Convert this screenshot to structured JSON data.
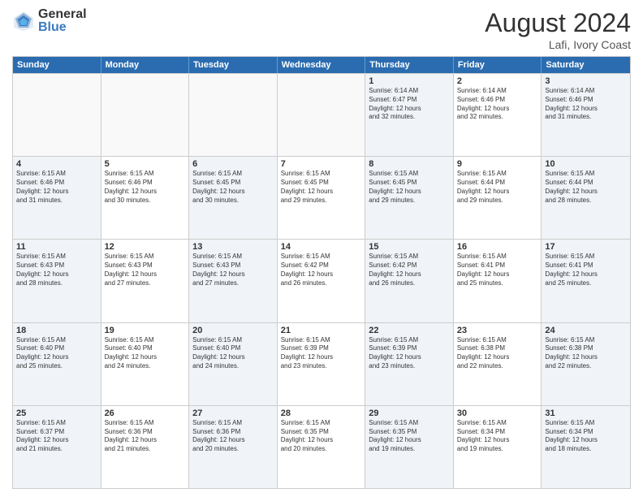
{
  "logo": {
    "general": "General",
    "blue": "Blue"
  },
  "title": "August 2024",
  "location": "Lafi, Ivory Coast",
  "days": [
    "Sunday",
    "Monday",
    "Tuesday",
    "Wednesday",
    "Thursday",
    "Friday",
    "Saturday"
  ],
  "weeks": [
    [
      {
        "day": "",
        "text": "",
        "empty": true
      },
      {
        "day": "",
        "text": "",
        "empty": true
      },
      {
        "day": "",
        "text": "",
        "empty": true
      },
      {
        "day": "",
        "text": "",
        "empty": true
      },
      {
        "day": "1",
        "text": "Sunrise: 6:14 AM\nSunset: 6:47 PM\nDaylight: 12 hours\nand 32 minutes.",
        "empty": false
      },
      {
        "day": "2",
        "text": "Sunrise: 6:14 AM\nSunset: 6:46 PM\nDaylight: 12 hours\nand 32 minutes.",
        "empty": false
      },
      {
        "day": "3",
        "text": "Sunrise: 6:14 AM\nSunset: 6:46 PM\nDaylight: 12 hours\nand 31 minutes.",
        "empty": false
      }
    ],
    [
      {
        "day": "4",
        "text": "Sunrise: 6:15 AM\nSunset: 6:46 PM\nDaylight: 12 hours\nand 31 minutes.",
        "empty": false
      },
      {
        "day": "5",
        "text": "Sunrise: 6:15 AM\nSunset: 6:46 PM\nDaylight: 12 hours\nand 30 minutes.",
        "empty": false
      },
      {
        "day": "6",
        "text": "Sunrise: 6:15 AM\nSunset: 6:45 PM\nDaylight: 12 hours\nand 30 minutes.",
        "empty": false
      },
      {
        "day": "7",
        "text": "Sunrise: 6:15 AM\nSunset: 6:45 PM\nDaylight: 12 hours\nand 29 minutes.",
        "empty": false
      },
      {
        "day": "8",
        "text": "Sunrise: 6:15 AM\nSunset: 6:45 PM\nDaylight: 12 hours\nand 29 minutes.",
        "empty": false
      },
      {
        "day": "9",
        "text": "Sunrise: 6:15 AM\nSunset: 6:44 PM\nDaylight: 12 hours\nand 29 minutes.",
        "empty": false
      },
      {
        "day": "10",
        "text": "Sunrise: 6:15 AM\nSunset: 6:44 PM\nDaylight: 12 hours\nand 28 minutes.",
        "empty": false
      }
    ],
    [
      {
        "day": "11",
        "text": "Sunrise: 6:15 AM\nSunset: 6:43 PM\nDaylight: 12 hours\nand 28 minutes.",
        "empty": false
      },
      {
        "day": "12",
        "text": "Sunrise: 6:15 AM\nSunset: 6:43 PM\nDaylight: 12 hours\nand 27 minutes.",
        "empty": false
      },
      {
        "day": "13",
        "text": "Sunrise: 6:15 AM\nSunset: 6:43 PM\nDaylight: 12 hours\nand 27 minutes.",
        "empty": false
      },
      {
        "day": "14",
        "text": "Sunrise: 6:15 AM\nSunset: 6:42 PM\nDaylight: 12 hours\nand 26 minutes.",
        "empty": false
      },
      {
        "day": "15",
        "text": "Sunrise: 6:15 AM\nSunset: 6:42 PM\nDaylight: 12 hours\nand 26 minutes.",
        "empty": false
      },
      {
        "day": "16",
        "text": "Sunrise: 6:15 AM\nSunset: 6:41 PM\nDaylight: 12 hours\nand 25 minutes.",
        "empty": false
      },
      {
        "day": "17",
        "text": "Sunrise: 6:15 AM\nSunset: 6:41 PM\nDaylight: 12 hours\nand 25 minutes.",
        "empty": false
      }
    ],
    [
      {
        "day": "18",
        "text": "Sunrise: 6:15 AM\nSunset: 6:40 PM\nDaylight: 12 hours\nand 25 minutes.",
        "empty": false
      },
      {
        "day": "19",
        "text": "Sunrise: 6:15 AM\nSunset: 6:40 PM\nDaylight: 12 hours\nand 24 minutes.",
        "empty": false
      },
      {
        "day": "20",
        "text": "Sunrise: 6:15 AM\nSunset: 6:40 PM\nDaylight: 12 hours\nand 24 minutes.",
        "empty": false
      },
      {
        "day": "21",
        "text": "Sunrise: 6:15 AM\nSunset: 6:39 PM\nDaylight: 12 hours\nand 23 minutes.",
        "empty": false
      },
      {
        "day": "22",
        "text": "Sunrise: 6:15 AM\nSunset: 6:39 PM\nDaylight: 12 hours\nand 23 minutes.",
        "empty": false
      },
      {
        "day": "23",
        "text": "Sunrise: 6:15 AM\nSunset: 6:38 PM\nDaylight: 12 hours\nand 22 minutes.",
        "empty": false
      },
      {
        "day": "24",
        "text": "Sunrise: 6:15 AM\nSunset: 6:38 PM\nDaylight: 12 hours\nand 22 minutes.",
        "empty": false
      }
    ],
    [
      {
        "day": "25",
        "text": "Sunrise: 6:15 AM\nSunset: 6:37 PM\nDaylight: 12 hours\nand 21 minutes.",
        "empty": false
      },
      {
        "day": "26",
        "text": "Sunrise: 6:15 AM\nSunset: 6:36 PM\nDaylight: 12 hours\nand 21 minutes.",
        "empty": false
      },
      {
        "day": "27",
        "text": "Sunrise: 6:15 AM\nSunset: 6:36 PM\nDaylight: 12 hours\nand 20 minutes.",
        "empty": false
      },
      {
        "day": "28",
        "text": "Sunrise: 6:15 AM\nSunset: 6:35 PM\nDaylight: 12 hours\nand 20 minutes.",
        "empty": false
      },
      {
        "day": "29",
        "text": "Sunrise: 6:15 AM\nSunset: 6:35 PM\nDaylight: 12 hours\nand 19 minutes.",
        "empty": false
      },
      {
        "day": "30",
        "text": "Sunrise: 6:15 AM\nSunset: 6:34 PM\nDaylight: 12 hours\nand 19 minutes.",
        "empty": false
      },
      {
        "day": "31",
        "text": "Sunrise: 6:15 AM\nSunset: 6:34 PM\nDaylight: 12 hours\nand 18 minutes.",
        "empty": false
      }
    ]
  ]
}
